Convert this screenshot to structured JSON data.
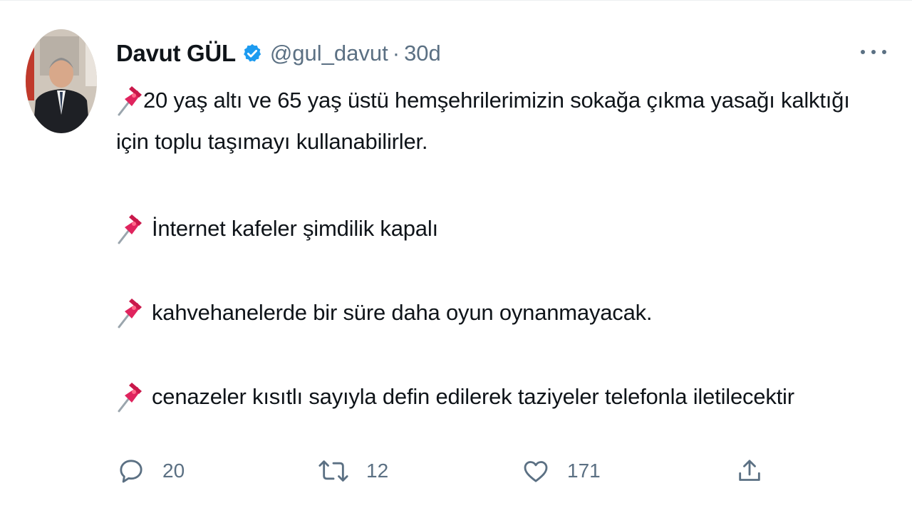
{
  "tweet": {
    "author_name": "Davut GÜL",
    "handle": "@gul_davut",
    "separator": "·",
    "time": "30d",
    "lines": [
      "20 yaş altı ve 65 yaş üstü hemşehrilerimizin sokağa çıkma yasağı kalktığı",
      "için toplu taşımayı kullanabilirler.",
      "İnternet kafeler şimdilik kapalı",
      "kahvehanelerde bir süre daha oyun oynanmayacak.",
      "cenazeler kısıtlı sayıyla defin edilerek taziyeler telefonla iletilecektir"
    ],
    "actions": {
      "reply_count": "20",
      "retweet_count": "12",
      "like_count": "171"
    }
  },
  "icons": {
    "verified": "verified-badge-icon",
    "pin": "pushpin-icon",
    "more": "more-icon",
    "reply": "reply-icon",
    "retweet": "retweet-icon",
    "like": "heart-icon",
    "share": "share-icon"
  },
  "colors": {
    "name": "#0f1419",
    "secondary": "#5b7083",
    "verified": "#1d9bf0",
    "pin": "#e0245e"
  }
}
